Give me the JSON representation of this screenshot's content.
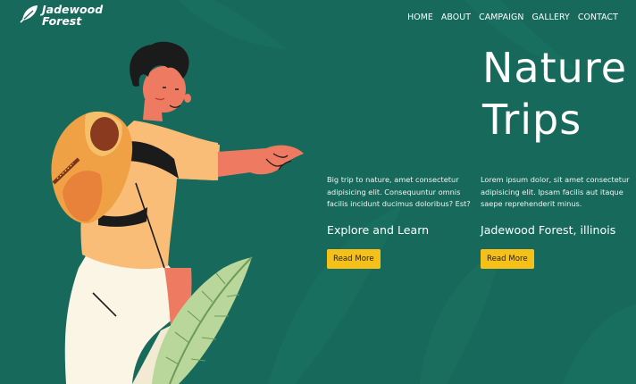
{
  "brand": {
    "line1": "Jadewood",
    "line2": "Forest"
  },
  "nav": {
    "items": [
      "HOME",
      "ABOUT",
      "CAMPAIGN",
      "GALLERY",
      "CONTACT"
    ]
  },
  "hero": {
    "title_line1": "Nature",
    "title_line2": "Trips"
  },
  "columns": [
    {
      "text": "Big trip to nature, amet consectetur adipisicing elit. Consequuntur omnis facilis incidunt ducimus doloribus? Est?",
      "heading": "Explore and Learn",
      "button": "Read More"
    },
    {
      "text": "Lorem ipsum dolor, sit amet consectetur adipisicing elit. Ipsam facilis aut itaque saepe reprehenderit minus.",
      "heading": "Jadewood Forest, illinois",
      "button": "Read More"
    }
  ],
  "colors": {
    "background": "#176a5b",
    "button": "#f5c01a",
    "text": "#ffffff"
  },
  "icons": {
    "logo": "leaf-logo-icon"
  }
}
